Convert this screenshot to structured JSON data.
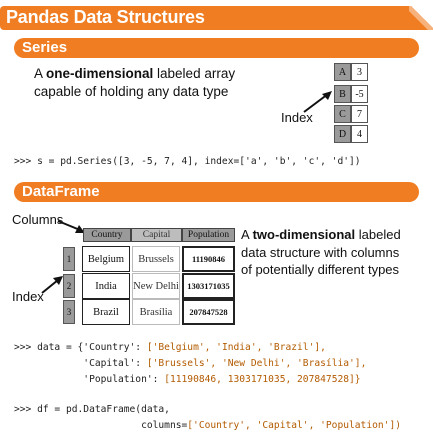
{
  "title": "Pandas Data Structures",
  "series_section": {
    "header": "Series",
    "desc_line1_bold": "one-dimensional",
    "desc_line1_pre": "A ",
    "desc_line1_post": " labeled array",
    "desc_line2": "capable of holding any data type",
    "index_label": "Index",
    "index": [
      "A",
      "B",
      "C",
      "D"
    ],
    "values": [
      "3",
      "-5",
      "7",
      "4"
    ],
    "code": ">>> s = pd.Series([3, -5, 7, 4], index=['a', 'b', 'c', 'd'])"
  },
  "dataframe_section": {
    "header": "DataFrame",
    "columns_label": "Columns",
    "index_label": "Index",
    "desc_line1_pre": "A ",
    "desc_line1_bold": "two-dimensional",
    "desc_line1_post": " labeled",
    "desc_line2": "data structure with columns",
    "desc_line3": "of potentially different types",
    "columns": [
      "Country",
      "Capital",
      "Population"
    ],
    "index": [
      "1",
      "2",
      "3"
    ],
    "rows": [
      [
        "Belgium",
        "Brussels",
        "11190846"
      ],
      [
        "India",
        "New Delhi",
        "1303171035"
      ],
      [
        "Brazil",
        "Brasília",
        "207847528"
      ]
    ],
    "code_data_l1_pre": ">>> data = {'Country': ",
    "code_data_l1_str": "['Belgium', 'India', 'Brazil'],",
    "code_data_l2_pre": "            'Capital': ",
    "code_data_l2_str": "['Brussels', 'New Delhi', 'Brasília'],",
    "code_data_l3_pre": "            'Population': ",
    "code_data_l3_str": "[11190846, 1303171035, 207847528]}",
    "code_df_l1": ">>> df = pd.DataFrame(data,",
    "code_df_l2_pre": "                      columns=",
    "code_df_l2_str": "['Country', 'Capital', 'Population'])"
  },
  "colors": {
    "accent": "#f07d22",
    "index_gray": "#9a9a9a"
  }
}
